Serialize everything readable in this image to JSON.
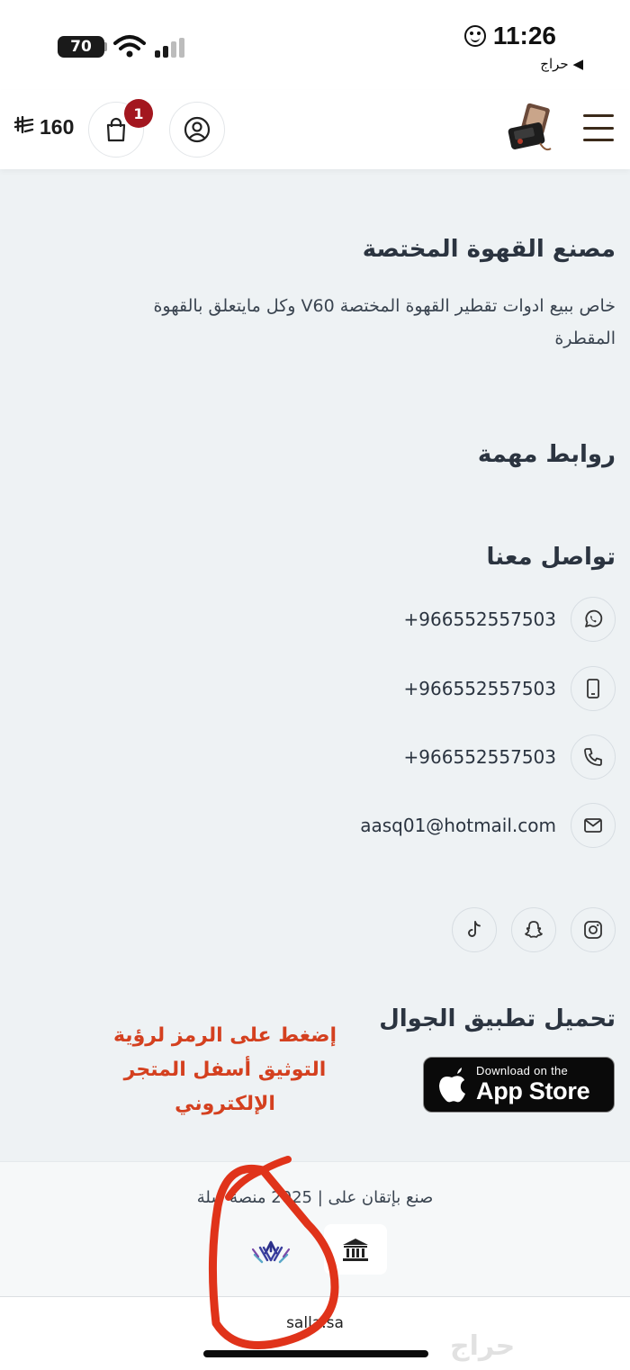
{
  "status_bar": {
    "battery": "70",
    "time": "11:26",
    "back_app": "◀ حراج"
  },
  "header": {
    "cart_total": "160",
    "currency_symbol": "⃁",
    "cart_count": "1"
  },
  "about": {
    "title": "مصنع القهوة المختصة",
    "description": "خاص ببيع ادوات تقطير القهوة المختصة V60 وكل مايتعلق بالقهوة المقطرة"
  },
  "links": {
    "title": "روابط مهمة"
  },
  "contact": {
    "title": "تواصل معنا",
    "items": [
      {
        "icon": "whatsapp-icon",
        "text": "+966552557503"
      },
      {
        "icon": "mobile-icon",
        "text": "+966552557503"
      },
      {
        "icon": "phone-icon",
        "text": "+966552557503"
      },
      {
        "icon": "mail-icon",
        "text": "aasq01@hotmail.com"
      }
    ]
  },
  "social": [
    "instagram-icon",
    "snapchat-icon",
    "tiktok-icon"
  ],
  "app": {
    "title": "تحميل تطبيق الجوال",
    "store_small": "Download on the",
    "store_big": "App Store"
  },
  "annotation": {
    "line1": "إضغط على الرمز لرؤية",
    "line2": "التوثيق أسفل المتجر",
    "line3": "الإلكتروني"
  },
  "footer": {
    "copyright": "صنع بإتقان على | 2025 منصة سلة"
  },
  "bottom": {
    "domain": "salla.sa",
    "watermark": "حراج"
  },
  "colors": {
    "badge": "#a3171f",
    "annotation": "#d4401f",
    "background": "#eef2f4"
  }
}
